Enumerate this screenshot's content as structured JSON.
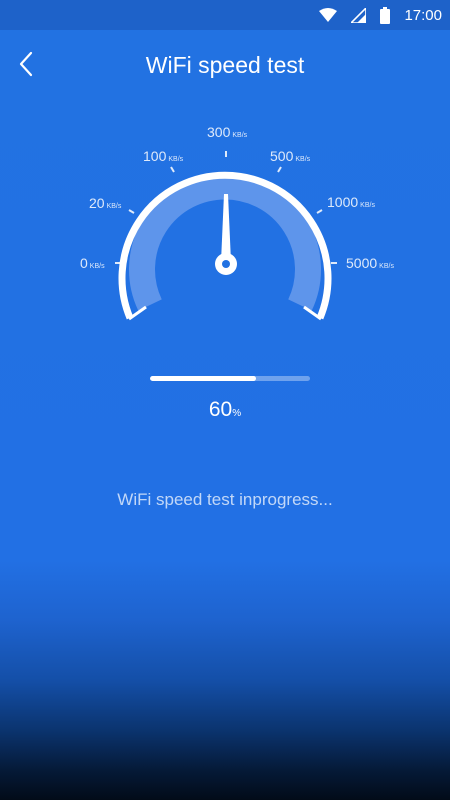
{
  "status_bar": {
    "time": "17:00",
    "icons": [
      "wifi-icon",
      "signal-icon",
      "battery-icon"
    ]
  },
  "header": {
    "back_icon": "chevron-left-icon",
    "title": "WiFi speed test"
  },
  "gauge": {
    "unit": "KB/s",
    "ticks": [
      {
        "value": "0",
        "unit": "KB/s"
      },
      {
        "value": "20",
        "unit": "KB/s"
      },
      {
        "value": "100",
        "unit": "KB/s"
      },
      {
        "value": "300",
        "unit": "KB/s"
      },
      {
        "value": "500",
        "unit": "KB/s"
      },
      {
        "value": "1000",
        "unit": "KB/s"
      },
      {
        "value": "5000",
        "unit": "KB/s"
      }
    ],
    "needle_value": "300"
  },
  "progress": {
    "fraction": 0.66,
    "value": "60",
    "unit": "%"
  },
  "status_message": "WiFi speed test inprogress...",
  "colors": {
    "background": "#2272e2",
    "status_bar": "#1e62c9",
    "accent": "#ffffff"
  }
}
